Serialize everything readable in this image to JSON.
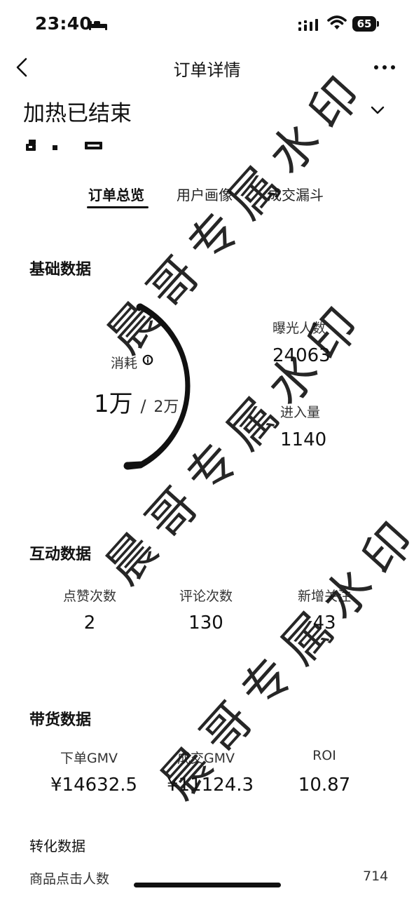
{
  "status_bar": {
    "time": "23:40",
    "battery": "65"
  },
  "nav": {
    "title": "订单详情"
  },
  "order": {
    "status": "加热已结束"
  },
  "tabs": [
    {
      "label": "订单总览",
      "active": true
    },
    {
      "label": "用户画像",
      "active": false
    },
    {
      "label": "成交漏斗",
      "active": false
    }
  ],
  "basic_data": {
    "title": "基础数据",
    "consume_label": "消耗",
    "consume_value": "1万",
    "consume_separator": "/",
    "consume_budget": "2万",
    "consume_ratio": 0.5,
    "exposure_label": "曝光人数",
    "exposure_value": "24063",
    "entry_label": "进入量",
    "entry_value": "1140"
  },
  "interaction_data": {
    "title": "互动数据",
    "metrics": [
      {
        "label": "点赞次数",
        "value": "2"
      },
      {
        "label": "评论次数",
        "value": "130"
      },
      {
        "label": "新增关注",
        "value": "43"
      }
    ]
  },
  "commerce_data": {
    "title": "带货数据",
    "metrics": [
      {
        "label": "下单GMV",
        "value": "¥14632.5"
      },
      {
        "label": "成交GMV",
        "value": "¥11124.3"
      },
      {
        "label": "ROI",
        "value": "10.87"
      }
    ]
  },
  "conversion_data": {
    "title": "转化数据",
    "partial_label": "商品点击人数",
    "partial_value": "714"
  },
  "watermark": {
    "text": "晨哥专属水印"
  },
  "icons": {
    "back": "chevron-left",
    "more": "ellipsis-horizontal",
    "expand": "chevron-down",
    "info": "info",
    "bed": "sleep-focus",
    "signal": "cellular-signal",
    "wifi": "wifi",
    "battery": "battery"
  },
  "colors": {
    "text": "#111111",
    "secondary_text": "#333333",
    "gauge_stroke": "#111111"
  }
}
